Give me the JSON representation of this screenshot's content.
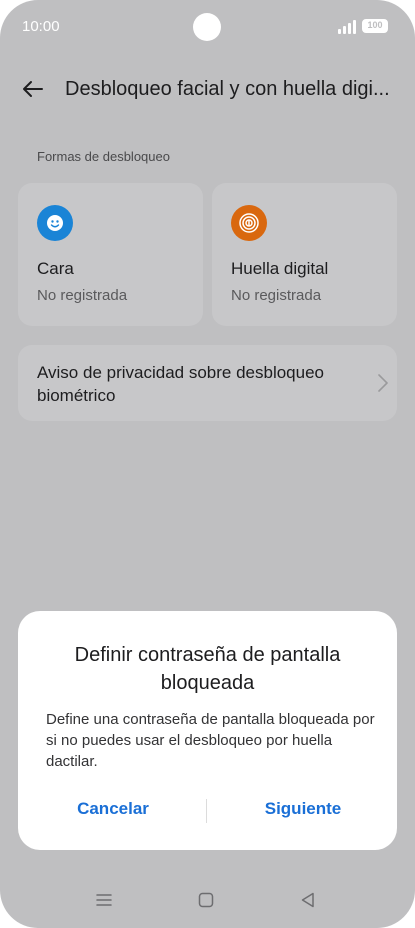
{
  "status_bar": {
    "time": "10:00",
    "battery": "100"
  },
  "header": {
    "title": "Desbloqueo facial y con huella digi..."
  },
  "section": {
    "label": "Formas de desbloqueo"
  },
  "cards": [
    {
      "title": "Cara",
      "subtitle": "No registrada",
      "icon": "face-icon",
      "color": "#1a84d6"
    },
    {
      "title": "Huella digital",
      "subtitle": "No registrada",
      "icon": "fingerprint-icon",
      "color": "#d9680f"
    }
  ],
  "privacy": {
    "label": "Aviso de privacidad sobre desbloqueo biométrico"
  },
  "dialog": {
    "title": "Definir contraseña de pantalla bloqueada",
    "body": "Define una contraseña de pantalla bloqueada por si no puedes usar el desbloqueo por huella dactilar.",
    "cancel_label": "Cancelar",
    "next_label": "Siguiente",
    "accent_color": "#1a6fd6"
  },
  "navbar": {
    "icons": [
      "menu-icon",
      "home-icon",
      "back-triangle-icon"
    ]
  }
}
